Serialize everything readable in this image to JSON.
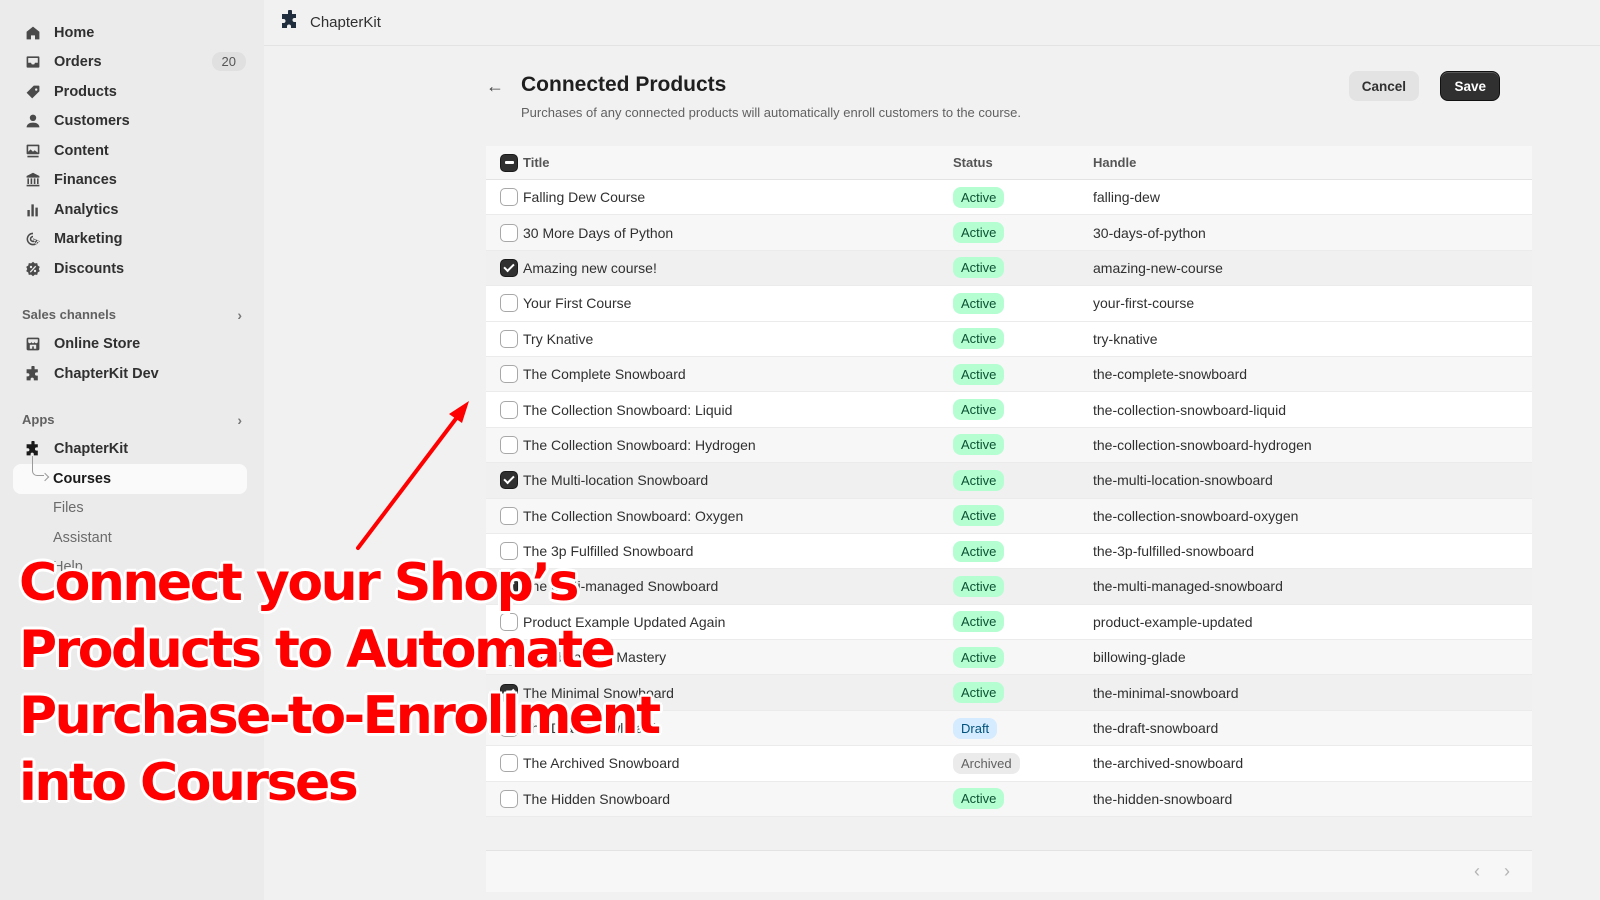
{
  "sidebar": {
    "main_items": [
      {
        "label": "Home",
        "icon": "home-icon"
      },
      {
        "label": "Orders",
        "icon": "inbox-icon",
        "badge": "20"
      },
      {
        "label": "Products",
        "icon": "tag-icon"
      },
      {
        "label": "Customers",
        "icon": "person-icon"
      },
      {
        "label": "Content",
        "icon": "image-icon"
      },
      {
        "label": "Finances",
        "icon": "bank-icon"
      },
      {
        "label": "Analytics",
        "icon": "bar-chart-icon"
      },
      {
        "label": "Marketing",
        "icon": "target-icon"
      },
      {
        "label": "Discounts",
        "icon": "discount-icon"
      }
    ],
    "sales_channels": {
      "heading": "Sales channels",
      "items": [
        {
          "label": "Online Store",
          "icon": "store-icon"
        },
        {
          "label": "ChapterKit Dev",
          "icon": "puzzle-icon"
        }
      ]
    },
    "apps": {
      "heading": "Apps",
      "app_label": "ChapterKit",
      "sub_items": [
        {
          "label": "Courses",
          "active": true
        },
        {
          "label": "Files"
        },
        {
          "label": "Assistant"
        },
        {
          "label": "Help"
        }
      ]
    }
  },
  "topbar": {
    "app_name": "ChapterKit"
  },
  "page": {
    "title": "Connected Products",
    "subtitle": "Purchases of any connected products will automatically enroll customers to the course.",
    "cancel_label": "Cancel",
    "save_label": "Save"
  },
  "table": {
    "headers": {
      "title": "Title",
      "status": "Status",
      "handle": "Handle"
    },
    "rows": [
      {
        "title": "Falling Dew Course",
        "status": "Active",
        "handle": "falling-dew",
        "checked": false
      },
      {
        "title": "30 More Days of Python",
        "status": "Active",
        "handle": "30-days-of-python",
        "checked": false
      },
      {
        "title": "Amazing new course!",
        "status": "Active",
        "handle": "amazing-new-course",
        "checked": true
      },
      {
        "title": "Your First Course",
        "status": "Active",
        "handle": "your-first-course",
        "checked": false
      },
      {
        "title": "Try Knative",
        "status": "Active",
        "handle": "try-knative",
        "checked": false
      },
      {
        "title": "The Complete Snowboard",
        "status": "Active",
        "handle": "the-complete-snowboard",
        "checked": false
      },
      {
        "title": "The Collection Snowboard: Liquid",
        "status": "Active",
        "handle": "the-collection-snowboard-liquid",
        "checked": false
      },
      {
        "title": "The Collection Snowboard: Hydrogen",
        "status": "Active",
        "handle": "the-collection-snowboard-hydrogen",
        "checked": false
      },
      {
        "title": "The Multi-location Snowboard",
        "status": "Active",
        "handle": "the-multi-location-snowboard",
        "checked": true
      },
      {
        "title": "The Collection Snowboard: Oxygen",
        "status": "Active",
        "handle": "the-collection-snowboard-oxygen",
        "checked": false
      },
      {
        "title": "The 3p Fulfilled Snowboard",
        "status": "Active",
        "handle": "the-3p-fulfilled-snowboard",
        "checked": false
      },
      {
        "title": "The Multi-managed Snowboard",
        "status": "Active",
        "handle": "the-multi-managed-snowboard",
        "checked": true
      },
      {
        "title": "Product Example Updated Again",
        "status": "Active",
        "handle": "product-example-updated",
        "checked": false
      },
      {
        "title": "Snowboarding Mastery",
        "status": "Active",
        "handle": "billowing-glade",
        "checked": false
      },
      {
        "title": "The Minimal Snowboard",
        "status": "Active",
        "handle": "the-minimal-snowboard",
        "checked": true
      },
      {
        "title": "The Draft Snowboard",
        "status": "Draft",
        "handle": "the-draft-snowboard",
        "checked": false
      },
      {
        "title": "The Archived Snowboard",
        "status": "Archived",
        "handle": "the-archived-snowboard",
        "checked": false
      },
      {
        "title": "The Hidden Snowboard",
        "status": "Active",
        "handle": "the-hidden-snowboard",
        "checked": false
      }
    ]
  },
  "pagination": {
    "prev": "‹",
    "next": "›"
  },
  "annotation": {
    "lines": [
      "Connect your Shop’s",
      "Products to Automate",
      "Purchase-to-Enrollment",
      "into Courses"
    ],
    "color": "#ff0000"
  }
}
